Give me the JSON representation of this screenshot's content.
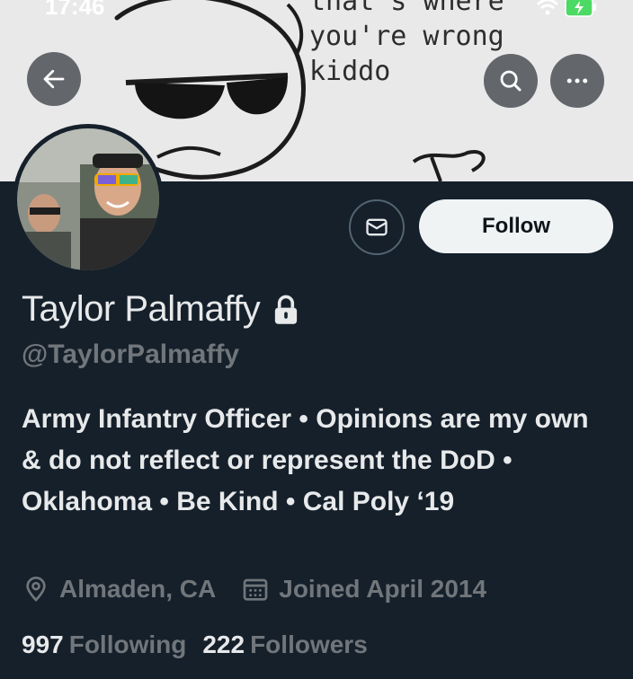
{
  "status_bar": {
    "time": "17:46"
  },
  "banner": {
    "meme_lines": [
      "that's where",
      "you're wrong",
      "kiddo"
    ]
  },
  "header": {
    "back_icon": "arrow-left-icon",
    "search_icon": "search-icon",
    "more_icon": "more-horizontal-icon"
  },
  "profile": {
    "display_name": "Taylor Palmaffy",
    "protected_icon": "lock-icon",
    "handle": "@TaylorPalmaffy",
    "follow_label": "Follow",
    "message_icon": "mail-icon",
    "bio": "Army Infantry Officer • Opinions are my own & do not reflect or represent the DoD • Oklahoma • Be Kind • Cal Poly ‘19",
    "location": "Almaden, CA",
    "joined": "Joined April 2014",
    "following_count": "997",
    "following_label": "Following",
    "followers_count": "222",
    "followers_label": "Followers"
  },
  "colors": {
    "background": "#15202b",
    "text_primary": "#e7e9ea",
    "text_secondary": "#71767b",
    "follow_button_bg": "#eff3f4"
  }
}
